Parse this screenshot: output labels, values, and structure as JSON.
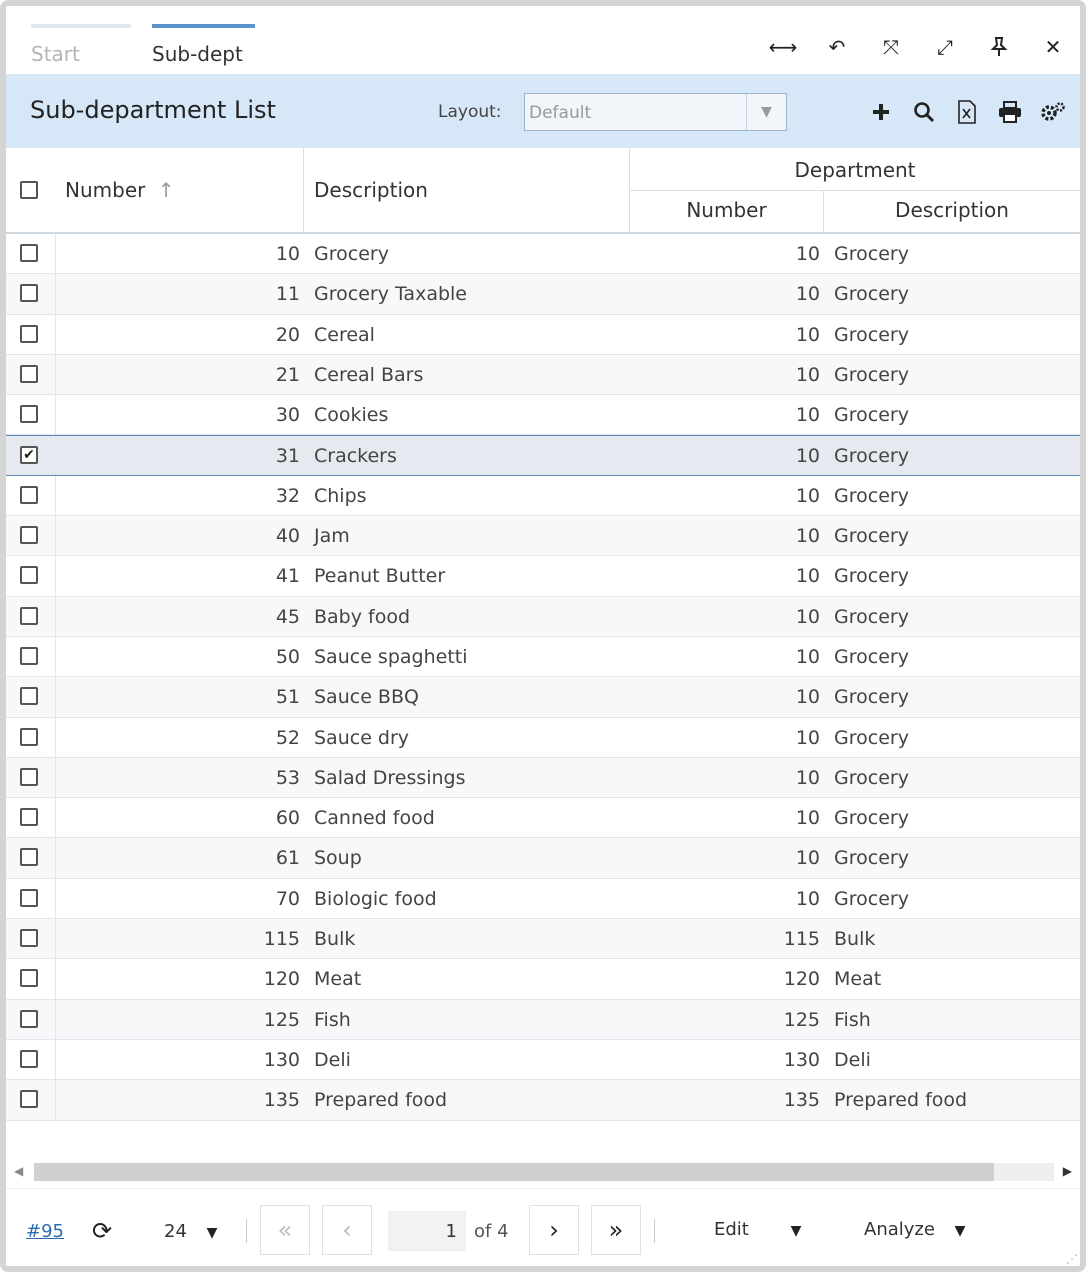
{
  "tabs": [
    {
      "label": "Start"
    },
    {
      "label": "Sub-dept"
    }
  ],
  "window_controls": [
    "resize-horizontal-icon",
    "undo-icon",
    "fullscreen-icon",
    "expand-icon",
    "pin-icon",
    "close-icon"
  ],
  "header": {
    "title": "Sub-department List",
    "layout_label": "Layout:",
    "layout_value": "Default"
  },
  "toolbar_icons": [
    "add-icon",
    "search-icon",
    "export-excel-icon",
    "print-icon",
    "settings-icon"
  ],
  "columns": {
    "number": "Number",
    "description": "Description",
    "department": "Department",
    "dept_number": "Number",
    "dept_description": "Description"
  },
  "rows": [
    {
      "number": "10",
      "description": "Grocery",
      "dept_number": "10",
      "dept_description": "Grocery",
      "checked": false
    },
    {
      "number": "11",
      "description": "Grocery Taxable",
      "dept_number": "10",
      "dept_description": "Grocery",
      "checked": false
    },
    {
      "number": "20",
      "description": "Cereal",
      "dept_number": "10",
      "dept_description": "Grocery",
      "checked": false
    },
    {
      "number": "21",
      "description": "Cereal Bars",
      "dept_number": "10",
      "dept_description": "Grocery",
      "checked": false
    },
    {
      "number": "30",
      "description": "Cookies",
      "dept_number": "10",
      "dept_description": "Grocery",
      "checked": false
    },
    {
      "number": "31",
      "description": "Crackers",
      "dept_number": "10",
      "dept_description": "Grocery",
      "checked": true
    },
    {
      "number": "32",
      "description": "Chips",
      "dept_number": "10",
      "dept_description": "Grocery",
      "checked": false
    },
    {
      "number": "40",
      "description": "Jam",
      "dept_number": "10",
      "dept_description": "Grocery",
      "checked": false
    },
    {
      "number": "41",
      "description": "Peanut Butter",
      "dept_number": "10",
      "dept_description": "Grocery",
      "checked": false
    },
    {
      "number": "45",
      "description": "Baby food",
      "dept_number": "10",
      "dept_description": "Grocery",
      "checked": false
    },
    {
      "number": "50",
      "description": "Sauce spaghetti",
      "dept_number": "10",
      "dept_description": "Grocery",
      "checked": false
    },
    {
      "number": "51",
      "description": "Sauce BBQ",
      "dept_number": "10",
      "dept_description": "Grocery",
      "checked": false
    },
    {
      "number": "52",
      "description": "Sauce dry",
      "dept_number": "10",
      "dept_description": "Grocery",
      "checked": false
    },
    {
      "number": "53",
      "description": "Salad Dressings",
      "dept_number": "10",
      "dept_description": "Grocery",
      "checked": false
    },
    {
      "number": "60",
      "description": "Canned food",
      "dept_number": "10",
      "dept_description": "Grocery",
      "checked": false
    },
    {
      "number": "61",
      "description": "Soup",
      "dept_number": "10",
      "dept_description": "Grocery",
      "checked": false
    },
    {
      "number": "70",
      "description": "Biologic food",
      "dept_number": "10",
      "dept_description": "Grocery",
      "checked": false
    },
    {
      "number": "115",
      "description": "Bulk",
      "dept_number": "115",
      "dept_description": "Bulk",
      "checked": false
    },
    {
      "number": "120",
      "description": "Meat",
      "dept_number": "120",
      "dept_description": "Meat",
      "checked": false
    },
    {
      "number": "125",
      "description": "Fish",
      "dept_number": "125",
      "dept_description": "Fish",
      "checked": false
    },
    {
      "number": "130",
      "description": "Deli",
      "dept_number": "130",
      "dept_description": "Deli",
      "checked": false
    },
    {
      "number": "135",
      "description": "Prepared food",
      "dept_number": "135",
      "dept_description": "Prepared food",
      "checked": false
    }
  ],
  "footer": {
    "record_id": "#95",
    "page_size": "24",
    "current_page": "1",
    "of_pages": "of 4",
    "edit_label": "Edit",
    "analyze_label": "Analyze"
  },
  "colors": {
    "header_bg": "#d6e7f7",
    "active_tab_bar": "#5c93c9",
    "link": "#2b6cb0"
  }
}
